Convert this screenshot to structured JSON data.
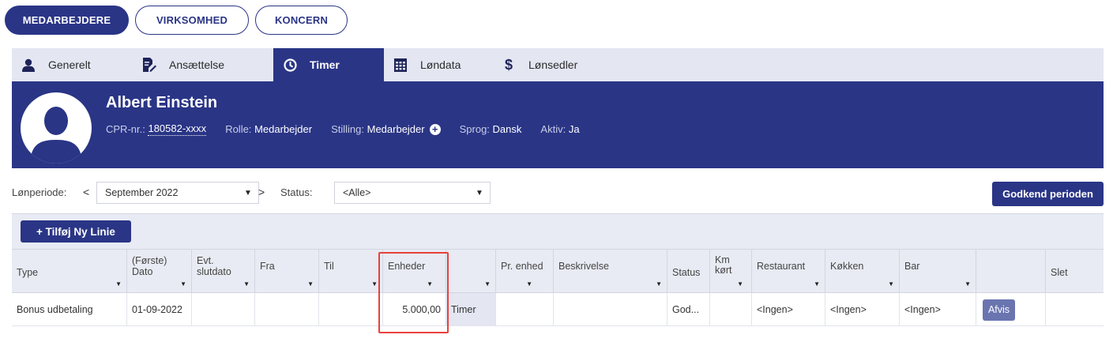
{
  "top_buttons": [
    "MEDARBEJDERE",
    "VIRKSOMHED",
    "KONCERN"
  ],
  "tabs": [
    {
      "label": "Generelt",
      "icon": "user-icon"
    },
    {
      "label": "Ansættelse",
      "icon": "contract-edit-icon"
    },
    {
      "label": "Timer",
      "icon": "clock-icon"
    },
    {
      "label": "Løndata",
      "icon": "table-icon"
    },
    {
      "label": "Lønsedler",
      "icon": "dollar-icon"
    }
  ],
  "active_tab": "Timer",
  "profile": {
    "name": "Albert Einstein",
    "cpr_label": "CPR-nr.:",
    "cpr_value": "180582-xxxx",
    "role_label": "Rolle:",
    "role_value": "Medarbejder",
    "position_label": "Stilling:",
    "position_value": "Medarbejder",
    "language_label": "Sprog:",
    "language_value": "Dansk",
    "active_label": "Aktiv:",
    "active_value": "Ja"
  },
  "filter": {
    "period_label": "Lønperiode:",
    "period_value": "September 2022",
    "prev_symbol": "<",
    "next_symbol": ">",
    "status_label": "Status:",
    "status_value": "<Alle>",
    "approve_label": "Godkend perioden"
  },
  "add_line_label": "+ Tilføj Ny Linie",
  "grid": {
    "headers": {
      "type": "Type",
      "date_line1": "(Første)",
      "date_line2": "Dato",
      "end_line1": "Evt.",
      "end_line2": "slutdato",
      "from": "Fra",
      "to": "Til",
      "units": "Enheder",
      "per_unit": "Pr. enhed",
      "description": "Beskrivelse",
      "status": "Status",
      "km_line1": "Km",
      "km_line2": "kørt",
      "restaurant": "Restaurant",
      "kitchen": "Køkken",
      "bar": "Bar",
      "delete": "Slet"
    },
    "rows": [
      {
        "type": "Bonus udbetaling",
        "date": "01-09-2022",
        "end_date": "",
        "from": "",
        "to": "",
        "units": "5.000,00",
        "unit_type": "Timer",
        "per_unit": "",
        "description": "",
        "status": "God...",
        "km": "",
        "restaurant": "<Ingen>",
        "kitchen": "<Ingen>",
        "bar": "<Ingen>",
        "action": "Afvis"
      }
    ]
  },
  "colors": {
    "brand": "#2a3586",
    "tab_bg": "#e4e7f2",
    "highlight": "#e8413b"
  }
}
